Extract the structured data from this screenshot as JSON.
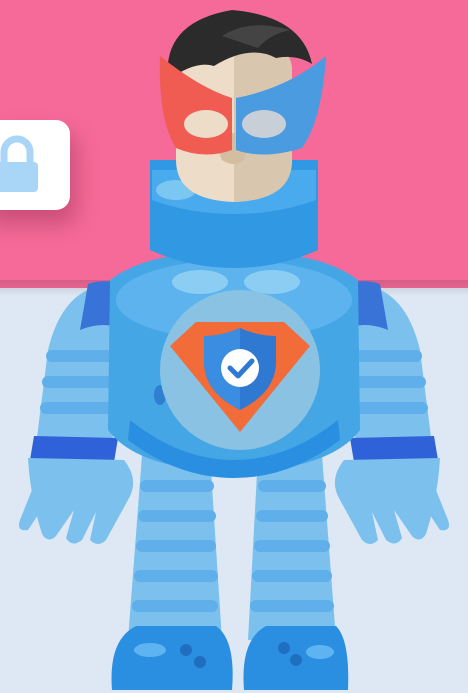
{
  "colors": {
    "background_top": "#f56a98",
    "background_bottom": "#dde8f4",
    "suit_light": "#7cc1ee",
    "suit_mid": "#45a6e6",
    "suit_dark": "#2a7fd0",
    "cuff": "#2f62d8",
    "mask_red": "#f05c52",
    "mask_blue": "#4a9be0",
    "hair": "#2b2b2b",
    "skin": "#ecdcc8",
    "emblem_orange": "#f26c3a",
    "emblem_blue": "#2f79d2",
    "lock_color": "#a9d6f6"
  },
  "icons": {
    "lock_card": "lock-icon",
    "hero": "superhero-mascot-icon",
    "emblem": "shield-check-icon"
  }
}
